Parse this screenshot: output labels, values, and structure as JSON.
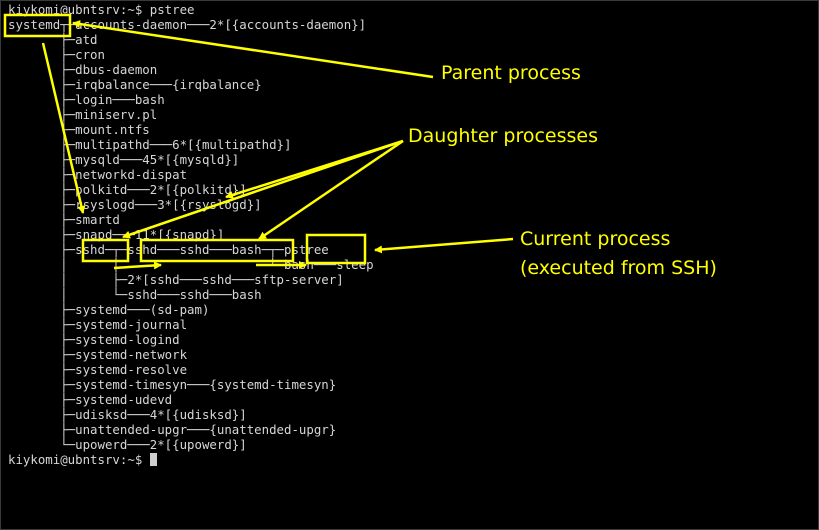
{
  "terminal": {
    "prompt_top": "kiykomi@ubntsrv:~$ pstree",
    "tree_lines": [
      "systemd┬─accounts-daemon───2*[{accounts-daemon}]",
      "       ├─atd",
      "       ├─cron",
      "       ├─dbus-daemon",
      "       ├─irqbalance───{irqbalance}",
      "       ├─login───bash",
      "       ├─miniserv.pl",
      "       ├─mount.ntfs",
      "       ├─multipathd───6*[{multipathd}]",
      "       ├─mysqld───45*[{mysqld}]",
      "       ├─networkd-dispat",
      "       ├─polkitd───2*[{polkitd}]",
      "       ├─rsyslogd───3*[{rsyslogd}]",
      "       ├─smartd",
      "       ├─snapd───11*[{snapd}]",
      "       ├─sshd─┬─sshd───sshd───bash─┬─pstree",
      "       │      │                    └─bash───sleep",
      "       │      ├─2*[sshd───sshd───sftp-server]",
      "       │      └─sshd───sshd───bash",
      "       ├─systemd───(sd-pam)",
      "       ├─systemd-journal",
      "       ├─systemd-logind",
      "       ├─systemd-network",
      "       ├─systemd-resolve",
      "       ├─systemd-timesyn───{systemd-timesyn}",
      "       ├─systemd-udevd",
      "       ├─udisksd───4*[{udisksd}]",
      "       ├─unattended-upgr───{unattended-upgr}",
      "       └─upowerd───2*[{upowerd}]"
    ],
    "prompt_bottom": "kiykomi@ubntsrv:~$ "
  },
  "annotations": {
    "parent": "Parent process",
    "daughter": "Daughter processes",
    "current_line1": "Current process",
    "current_line2": "(executed from SSH)"
  },
  "colors": {
    "background": "#000000",
    "text": "#d6d6d6",
    "annotation": "#ffff00"
  }
}
